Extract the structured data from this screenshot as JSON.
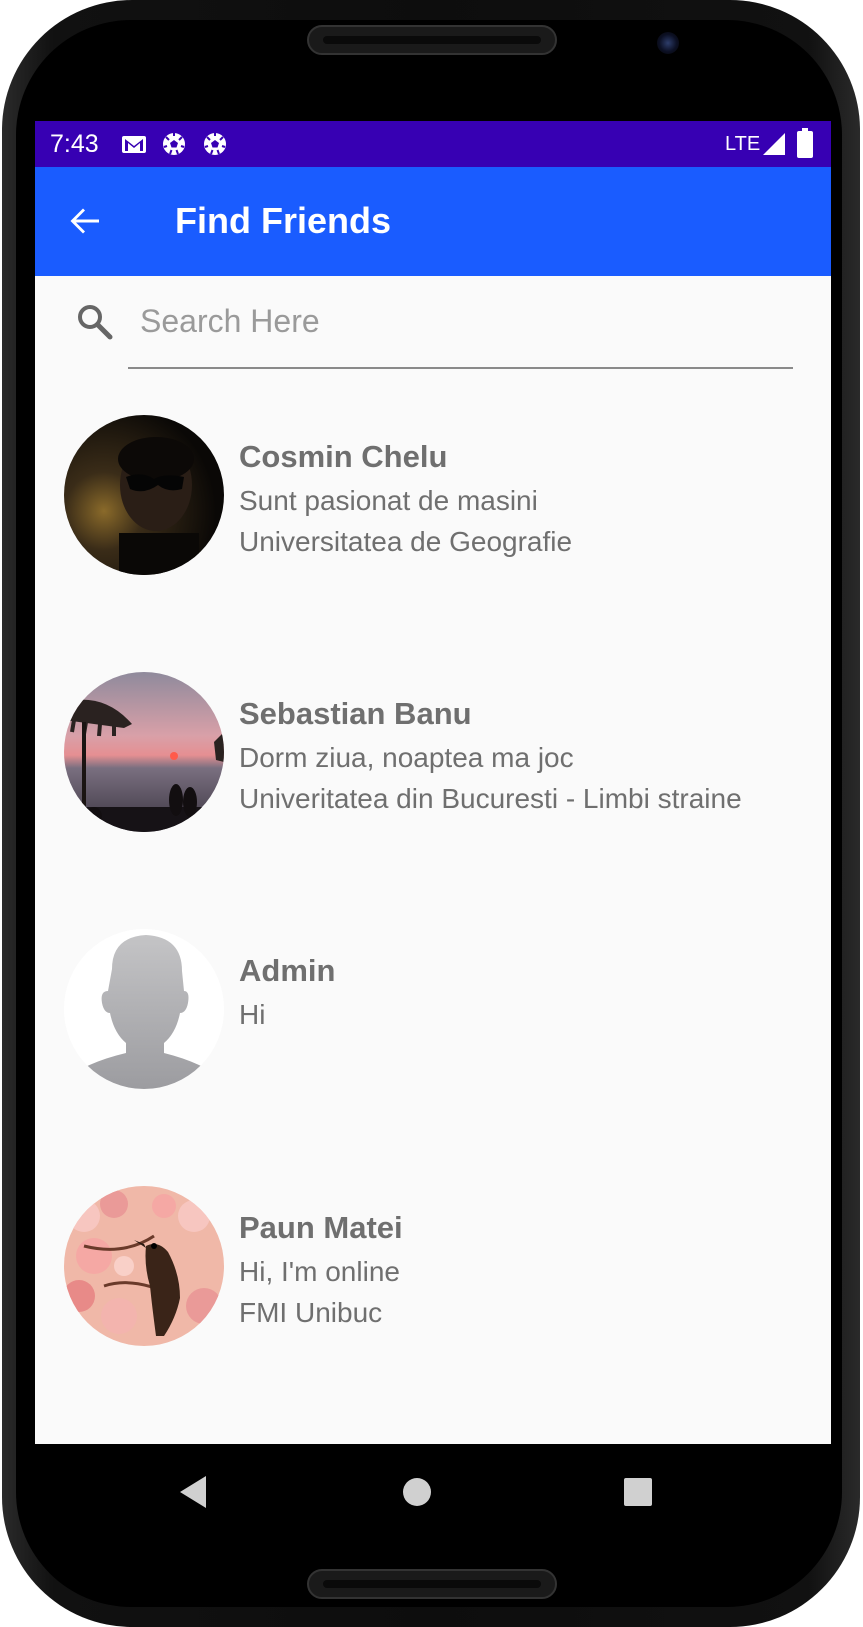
{
  "status_bar": {
    "time": "7:43",
    "icons": [
      "gmail-icon",
      "soccer-icon",
      "soccer-icon"
    ],
    "network": "LTE",
    "background": "#3700b3"
  },
  "app_bar": {
    "title": "Find Friends",
    "back_icon": "arrow-back-icon",
    "background": "#1a5cff"
  },
  "search": {
    "placeholder": "Search Here",
    "value": ""
  },
  "friends": [
    {
      "name": "Cosmin Chelu",
      "line1": "Sunt pasionat de masini",
      "line2": "Universitatea de Geografie",
      "avatar": "dark-photo"
    },
    {
      "name": "Sebastian Banu",
      "line1": "Dorm ziua, noaptea ma joc",
      "line2": "Univeritatea din Bucuresti - Limbi straine",
      "avatar": "sunset-beach-photo"
    },
    {
      "name": "Admin",
      "line1": "Hi",
      "line2": "",
      "avatar": "default-person"
    },
    {
      "name": "Paun Matei",
      "line1": "Hi, I'm online",
      "line2": "FMI Unibuc",
      "avatar": "bird-blossom-photo"
    }
  ],
  "nav_bar": {
    "buttons": [
      "back-triangle-icon",
      "home-circle-icon",
      "recents-square-icon"
    ]
  }
}
